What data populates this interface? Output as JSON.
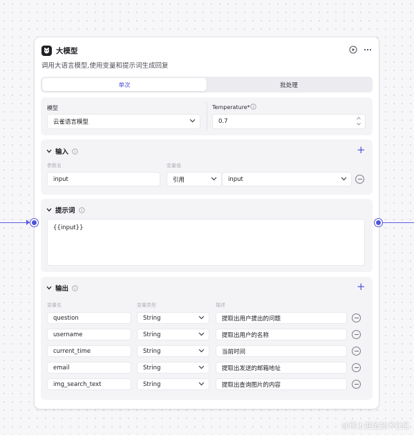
{
  "node": {
    "title": "大模型",
    "description": "调用大语言模型,使用变量和提示词生成回复",
    "tabs": [
      {
        "label": "单次",
        "active": true
      },
      {
        "label": "批处理",
        "active": false
      }
    ]
  },
  "model": {
    "label": "模型",
    "value": "云雀语言模型",
    "temperature_label": "Temperature*",
    "temperature_value": "0.7"
  },
  "input": {
    "title": "输入",
    "col_param": "参数名",
    "col_value": "变量值",
    "rows": [
      {
        "name": "input",
        "type": "引用",
        "ref": "input"
      }
    ]
  },
  "prompt": {
    "title": "提示词",
    "text": "{{input}}"
  },
  "output": {
    "title": "输出",
    "col_name": "变量名",
    "col_type": "变量类型",
    "col_desc": "描述",
    "rows": [
      {
        "name": "question",
        "type": "String",
        "desc": "提取出用户提出的问题"
      },
      {
        "name": "username",
        "type": "String",
        "desc": "提取出用户的名称"
      },
      {
        "name": "current_time",
        "type": "String",
        "desc": "当前时间"
      },
      {
        "name": "email",
        "type": "String",
        "desc": "提取出发送的邮箱地址"
      },
      {
        "name": "img_search_text",
        "type": "String",
        "desc": "提取出查询图片的内容"
      }
    ]
  },
  "watermark": "@稀土掘金技术社区",
  "colors": {
    "accent": "#4f52dc",
    "panel": "#f4f4f7",
    "canvas": "#f7f7f9"
  }
}
